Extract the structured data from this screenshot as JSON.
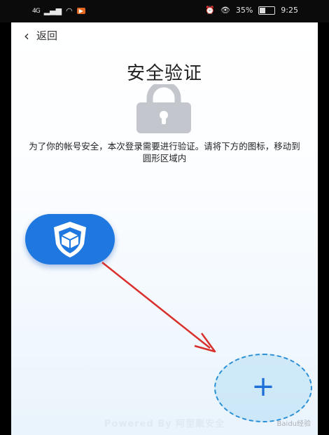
{
  "status_bar": {
    "signal": "4G",
    "battery_percent": "35%",
    "time": "9:25"
  },
  "nav": {
    "back_label": "返回"
  },
  "page": {
    "title": "安全验证",
    "instruction": "为了你的帐号安全，本次登录需要进行验证。请将下方的图标，移动到圆形区域内"
  },
  "target": {
    "symbol": "+"
  },
  "footer": {
    "text": "Powered By 阿里聚安全"
  },
  "watermark": {
    "text": "Baidu经验"
  },
  "colors": {
    "accent_blue": "#1f77e0",
    "arrow_red": "#d9302c",
    "lock_gray": "#c3c6cc"
  },
  "icons": [
    "back-chevron-icon",
    "lock-icon",
    "security-shield-icon",
    "plus-icon"
  ]
}
